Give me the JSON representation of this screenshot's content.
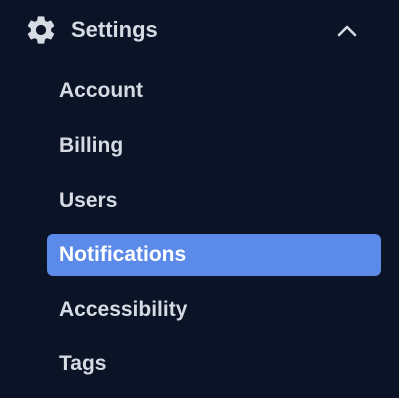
{
  "colors": {
    "background": "#0b1326",
    "text": "#d5dae3",
    "active_background": "#5b8ae8",
    "active_text": "#ffffff"
  },
  "section": {
    "icon": "gear-icon",
    "title": "Settings",
    "expanded": true,
    "toggle_icon": "chevron-up-icon"
  },
  "items": [
    {
      "label": "Account",
      "active": false
    },
    {
      "label": "Billing",
      "active": false
    },
    {
      "label": "Users",
      "active": false
    },
    {
      "label": "Notifications",
      "active": true
    },
    {
      "label": "Accessibility",
      "active": false
    },
    {
      "label": "Tags",
      "active": false
    }
  ]
}
